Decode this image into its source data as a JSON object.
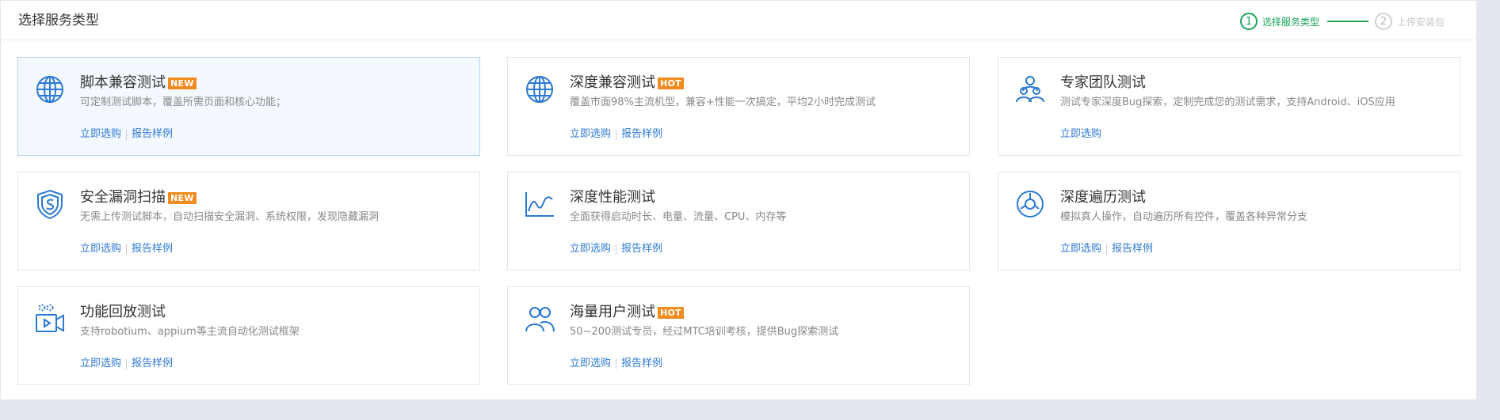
{
  "header": {
    "title": "选择服务类型",
    "steps": [
      {
        "number": "1",
        "label": "选择服务类型",
        "active": true
      },
      {
        "number": "2",
        "label": "上传安装包",
        "active": false
      }
    ]
  },
  "colors": {
    "accent": "#2c79d1",
    "step_active": "#19a55a",
    "badge": "#f28b1f"
  },
  "cards": [
    {
      "title": "脚本兼容测试",
      "badge": "NEW",
      "icon": "globe-icon",
      "desc": "可定制测试脚本，覆盖所需页面和核心功能；",
      "link1": "立即选购",
      "link2": "报告样例",
      "selected": true
    },
    {
      "title": "深度兼容测试",
      "badge": "HOT",
      "icon": "globe-icon",
      "desc": "覆盖市面98%主流机型，兼容+性能一次搞定，平均2小时完成测试",
      "link1": "立即选购",
      "link2": "报告样例"
    },
    {
      "title": "专家团队测试",
      "badge": "",
      "icon": "expert-team-icon",
      "desc": "测试专家深度Bug探索，定制完成您的测试需求，支持Android、iOS应用",
      "link1": "立即选购",
      "link2": ""
    },
    {
      "title": "安全漏洞扫描",
      "badge": "NEW",
      "icon": "shield-icon",
      "desc": "无需上传测试脚本，自动扫描安全漏洞、系统权限，发现隐藏漏洞",
      "link1": "立即选购",
      "link2": "报告样例"
    },
    {
      "title": "深度性能测试",
      "badge": "",
      "icon": "line-chart-icon",
      "desc": "全面获得启动时长、电量、流量、CPU、内存等",
      "link1": "立即选购",
      "link2": "报告样例"
    },
    {
      "title": "深度遍历测试",
      "badge": "",
      "icon": "traverse-icon",
      "desc": "模拟真人操作，自动遍历所有控件，覆盖各种异常分支",
      "link1": "立即选购",
      "link2": "报告样例"
    },
    {
      "title": "功能回放测试",
      "badge": "",
      "icon": "video-replay-icon",
      "desc": "支持robotium、appium等主流自动化测试框架",
      "link1": "立即选购",
      "link2": "报告样例"
    },
    {
      "title": "海量用户测试",
      "badge": "HOT",
      "icon": "users-icon",
      "desc": "50~200测试专员，经过MTC培训考核，提供Bug探索测试",
      "link1": "立即选购",
      "link2": "报告样例"
    }
  ]
}
